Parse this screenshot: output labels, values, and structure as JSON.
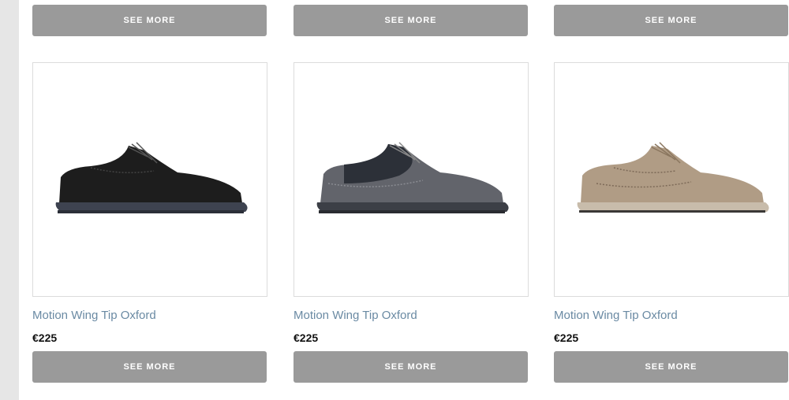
{
  "products": [
    {
      "title": "Motion Wing Tip Oxford",
      "price": "€225",
      "see_more": "SEE MORE",
      "top_see_more": "SEE MORE",
      "colors": {
        "upper": "#1d1d1d",
        "accent": "#2a2a2a",
        "sole": "#3e4350",
        "tread": "#2b2f38"
      }
    },
    {
      "title": "Motion Wing Tip Oxford",
      "price": "€225",
      "see_more": "SEE MORE",
      "top_see_more": "SEE MORE",
      "colors": {
        "upper": "#62646b",
        "accent": "#2c3038",
        "sole": "#3c3f46",
        "tread": "#2a2c31"
      }
    },
    {
      "title": "Motion Wing Tip Oxford",
      "price": "€225",
      "see_more": "SEE MORE",
      "top_see_more": "SEE MORE",
      "colors": {
        "upper": "#b09c85",
        "accent": "#9c8772",
        "sole": "#c8bcab",
        "tread": "#3a3836"
      }
    }
  ]
}
